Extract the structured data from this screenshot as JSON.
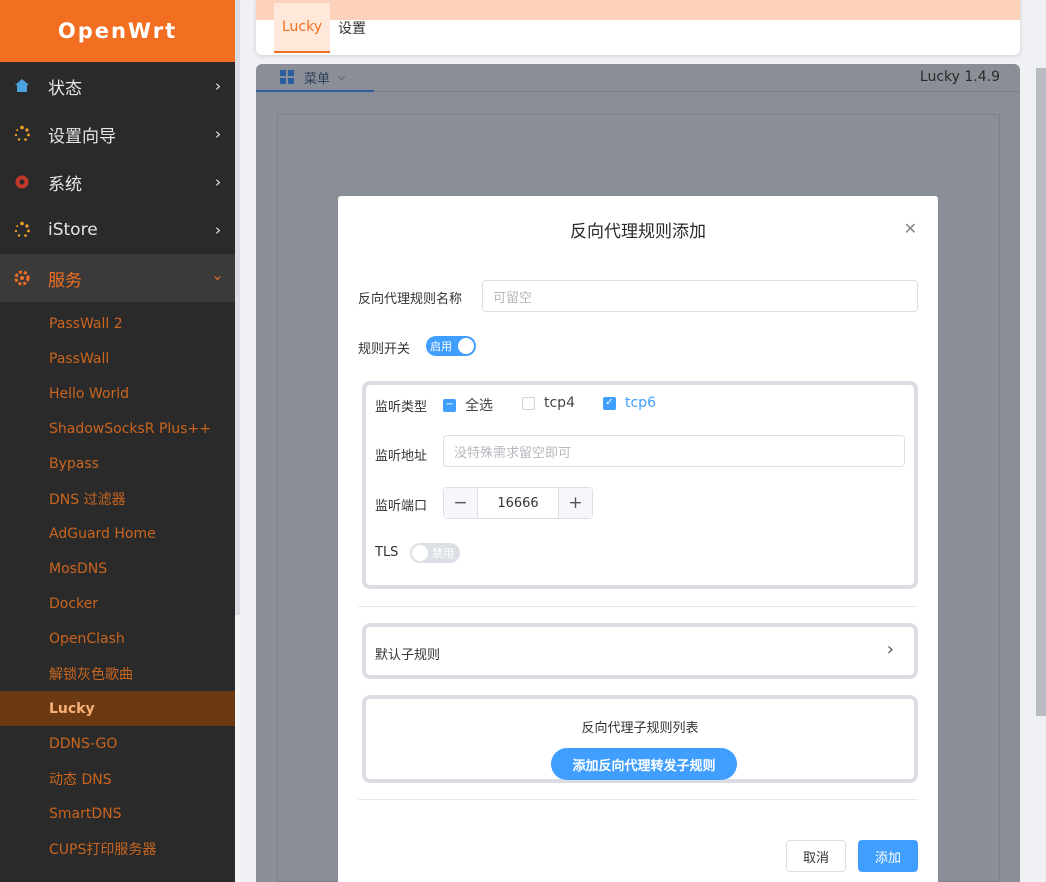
{
  "sidebar": {
    "brand": "OpenWrt",
    "menus": [
      {
        "label": "状态"
      },
      {
        "label": "设置向导"
      },
      {
        "label": "系统"
      },
      {
        "label": "iStore"
      },
      {
        "label": "服务"
      }
    ],
    "services": [
      "PassWall 2",
      "PassWall",
      "Hello World",
      "ShadowSocksR Plus++",
      "Bypass",
      "DNS 过滤器",
      "AdGuard Home",
      "MosDNS",
      "Docker",
      "OpenClash",
      "解锁灰色歌曲",
      "Lucky",
      "DDNS-GO",
      "动态 DNS",
      "SmartDNS",
      "CUPS打印服务器"
    ],
    "active_service": "Lucky"
  },
  "tabs": [
    "Lucky",
    "设置"
  ],
  "frame": {
    "menu_label": "菜单",
    "version": "Lucky 1.4.9"
  },
  "dialog": {
    "title": "反向代理规则添加",
    "name_label": "反向代理规则名称",
    "name_placeholder": "可留空",
    "rule_switch_label": "规则开关",
    "rule_switch_state": "启用",
    "listen_type_label": "监听类型",
    "listen_type_options": [
      {
        "label": "全选",
        "state": "indeterminate"
      },
      {
        "label": "tcp4",
        "state": "unchecked"
      },
      {
        "label": "tcp6",
        "state": "checked"
      }
    ],
    "listen_addr_label": "监听地址",
    "listen_addr_placeholder": "没特殊需求留空即可",
    "listen_port_label": "监听端口",
    "listen_port_value": "16666",
    "tls_label": "TLS",
    "tls_state": "禁用",
    "default_subrule_label": "默认子规则",
    "subrule_list_title": "反向代理子规则列表",
    "add_subrule_button": "添加反向代理转发子规则",
    "cancel_button": "取消",
    "confirm_button": "添加"
  },
  "colors": {
    "brand": "#f26f21",
    "primary": "#409eff"
  }
}
